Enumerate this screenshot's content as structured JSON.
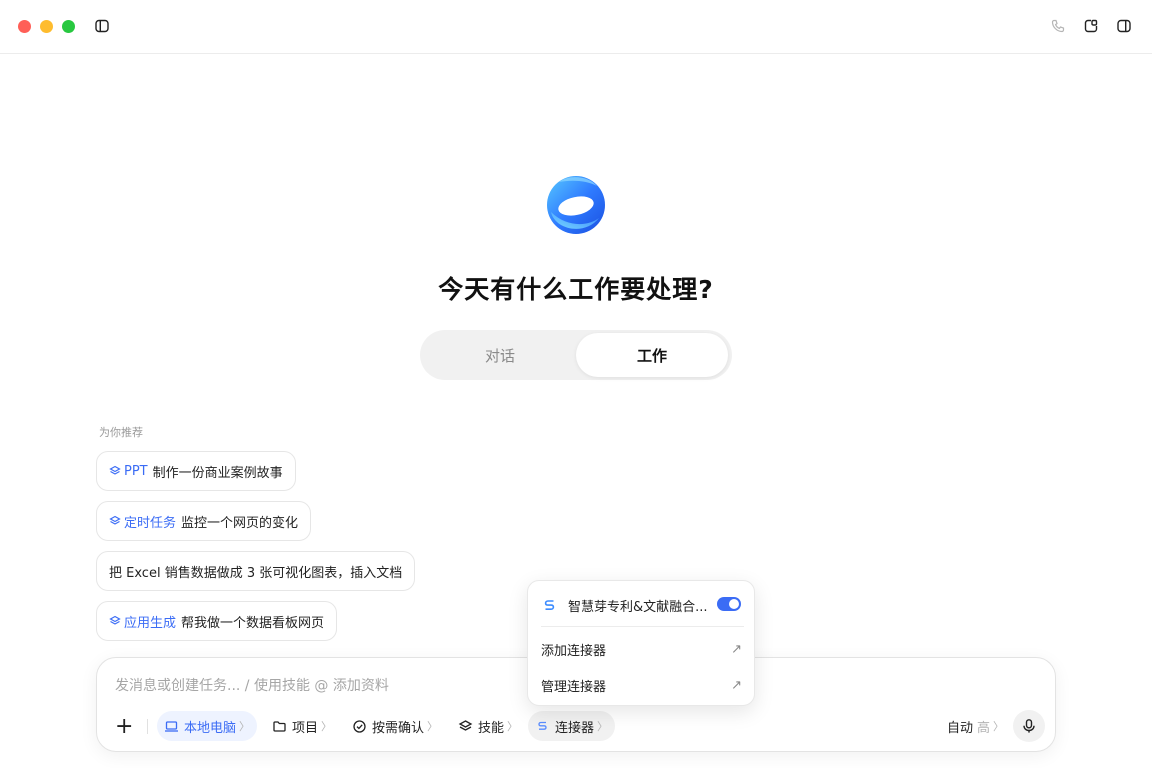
{
  "window": {
    "title_icons": [
      "sidebar-toggle-icon",
      "phone-icon",
      "new-chat-icon",
      "panel-icon"
    ]
  },
  "hero": {
    "headline": "今天有什么工作要处理?"
  },
  "mode_switch": {
    "chat_label": "对话",
    "work_label": "工作",
    "selected": "工作"
  },
  "recommendations": {
    "label": "为你推荐",
    "items": [
      {
        "tag": "PPT",
        "text": "制作一份商业案例故事"
      },
      {
        "tag": "定时任务",
        "text": "监控一个网页的变化"
      },
      {
        "tag": "",
        "text": "把 Excel 销售数据做成 3 张可视化图表，插入文档"
      },
      {
        "tag": "应用生成",
        "text": "帮我做一个数据看板网页"
      }
    ]
  },
  "composer": {
    "placeholder": "发消息或创建任务... / 使用技能 @ 添加资料",
    "tools": {
      "local_label": "本地电脑",
      "project_label": "项目",
      "confirm_label": "按需确认",
      "skills_label": "技能",
      "connectors_label": "连接器",
      "mode_label": "自动",
      "mode_level": "高",
      "chevron": "〉"
    }
  },
  "connector_popover": {
    "connector_name": "智慧芽专利&文献融合...",
    "connector_enabled": true,
    "add_label": "添加连接器",
    "manage_label": "管理连接器",
    "arrow": "↗"
  },
  "colors": {
    "accent": "#3b6cf5",
    "traffic_red": "#ff5f57",
    "traffic_yellow": "#febc2e",
    "traffic_green": "#28c840"
  }
}
